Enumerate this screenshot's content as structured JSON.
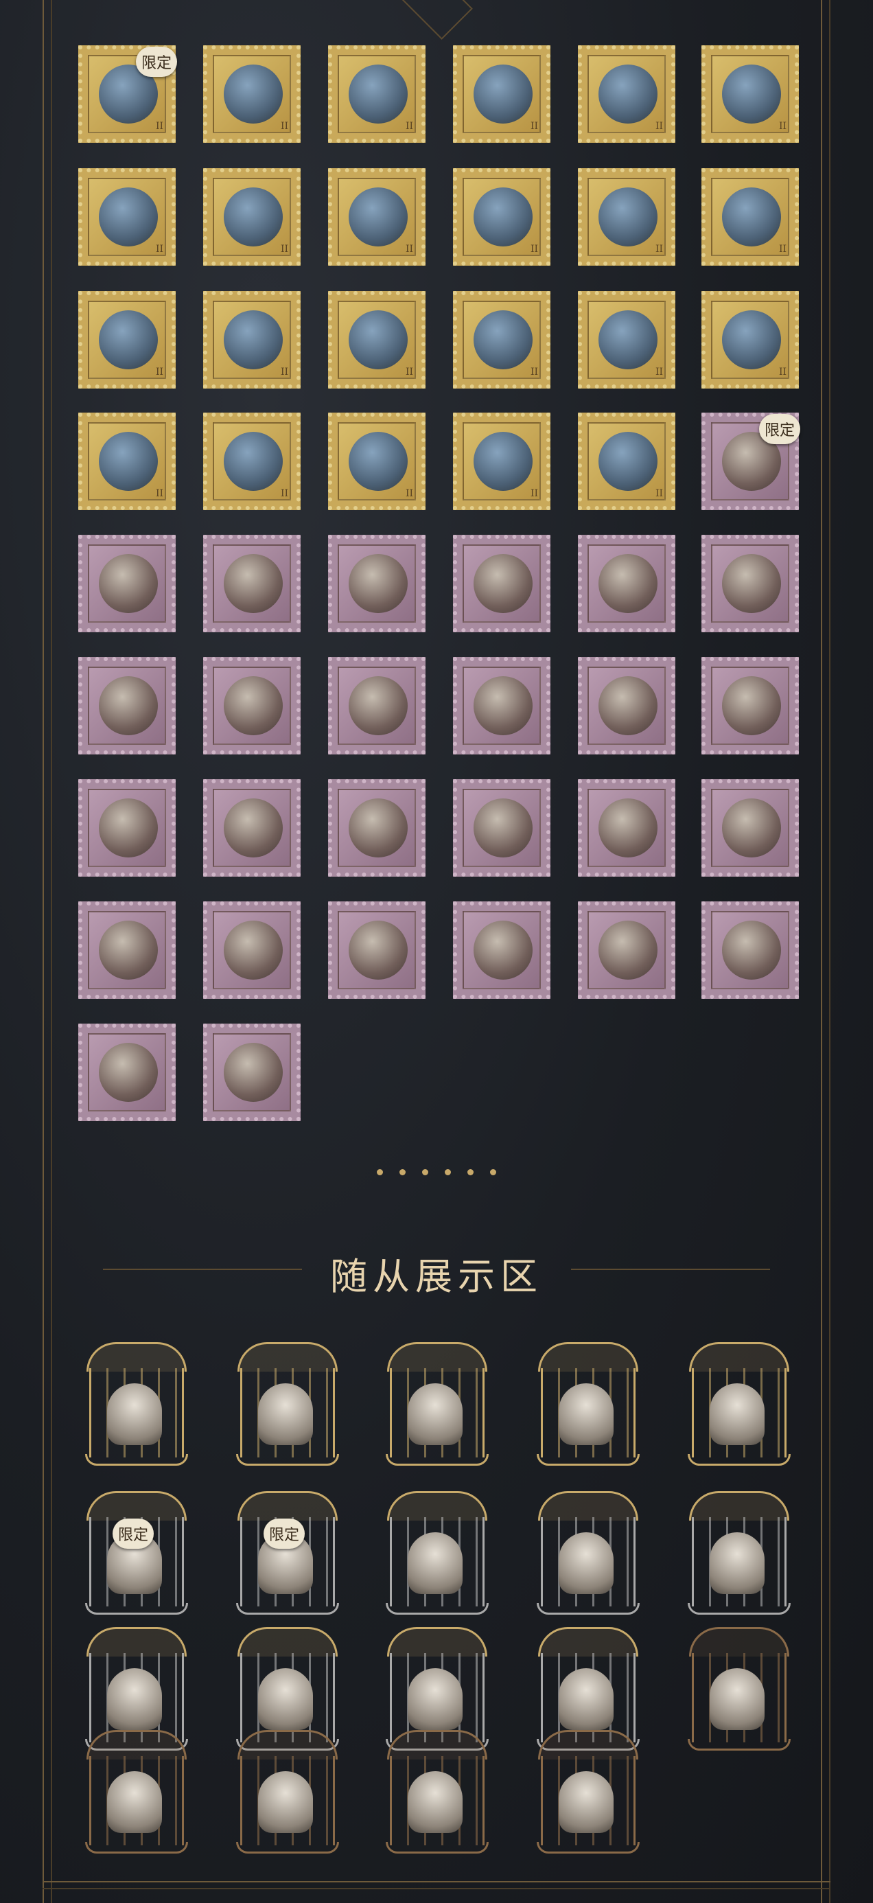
{
  "stamps": {
    "limited_label": "限定",
    "denomination": "II",
    "rows": [
      {
        "items": [
          {
            "type": "gold",
            "limited": true
          },
          {
            "type": "gold"
          },
          {
            "type": "gold"
          },
          {
            "type": "gold"
          },
          {
            "type": "gold"
          },
          {
            "type": "gold"
          }
        ]
      },
      {
        "items": [
          {
            "type": "gold"
          },
          {
            "type": "gold"
          },
          {
            "type": "gold"
          },
          {
            "type": "gold"
          },
          {
            "type": "gold"
          },
          {
            "type": "gold"
          }
        ]
      },
      {
        "items": [
          {
            "type": "gold"
          },
          {
            "type": "gold"
          },
          {
            "type": "gold"
          },
          {
            "type": "gold"
          },
          {
            "type": "gold"
          },
          {
            "type": "gold"
          }
        ]
      },
      {
        "items": [
          {
            "type": "gold"
          },
          {
            "type": "gold"
          },
          {
            "type": "gold"
          },
          {
            "type": "gold"
          },
          {
            "type": "gold"
          },
          {
            "type": "purple",
            "limited": true
          }
        ]
      },
      {
        "items": [
          {
            "type": "purple"
          },
          {
            "type": "purple"
          },
          {
            "type": "purple"
          },
          {
            "type": "purple"
          },
          {
            "type": "purple"
          },
          {
            "type": "purple"
          }
        ]
      },
      {
        "items": [
          {
            "type": "purple"
          },
          {
            "type": "purple"
          },
          {
            "type": "purple"
          },
          {
            "type": "purple"
          },
          {
            "type": "purple"
          },
          {
            "type": "purple"
          }
        ]
      },
      {
        "items": [
          {
            "type": "purple"
          },
          {
            "type": "purple"
          },
          {
            "type": "purple"
          },
          {
            "type": "purple"
          },
          {
            "type": "purple"
          },
          {
            "type": "purple"
          }
        ]
      },
      {
        "items": [
          {
            "type": "purple"
          },
          {
            "type": "purple"
          },
          {
            "type": "purple"
          },
          {
            "type": "purple"
          },
          {
            "type": "purple"
          },
          {
            "type": "purple"
          }
        ]
      },
      {
        "items": [
          {
            "type": "purple"
          },
          {
            "type": "purple"
          }
        ]
      }
    ]
  },
  "pets_section": {
    "title": "随从展示区",
    "limited_label": "限定",
    "rows": [
      {
        "items": [
          {
            "cage": "gold"
          },
          {
            "cage": "gold"
          },
          {
            "cage": "gold"
          },
          {
            "cage": "gold"
          },
          {
            "cage": "gold"
          }
        ]
      },
      {
        "items": [
          {
            "cage": "silver",
            "limited": true
          },
          {
            "cage": "silver",
            "limited": true
          },
          {
            "cage": "silver"
          },
          {
            "cage": "silver"
          },
          {
            "cage": "silver"
          }
        ]
      },
      {
        "items": [
          {
            "cage": "silver"
          },
          {
            "cage": "silver"
          },
          {
            "cage": "silver"
          },
          {
            "cage": "silver"
          },
          {
            "cage": "bronze"
          }
        ]
      },
      {
        "items": [
          {
            "cage": "bronze"
          },
          {
            "cage": "bronze"
          },
          {
            "cage": "bronze"
          },
          {
            "cage": "bronze"
          }
        ]
      }
    ]
  },
  "colors": {
    "gold_stamp": "#c9a95a",
    "purple_stamp": "#a88ba0",
    "accent": "#c8a96a",
    "title_text": "#e8d4ae"
  }
}
